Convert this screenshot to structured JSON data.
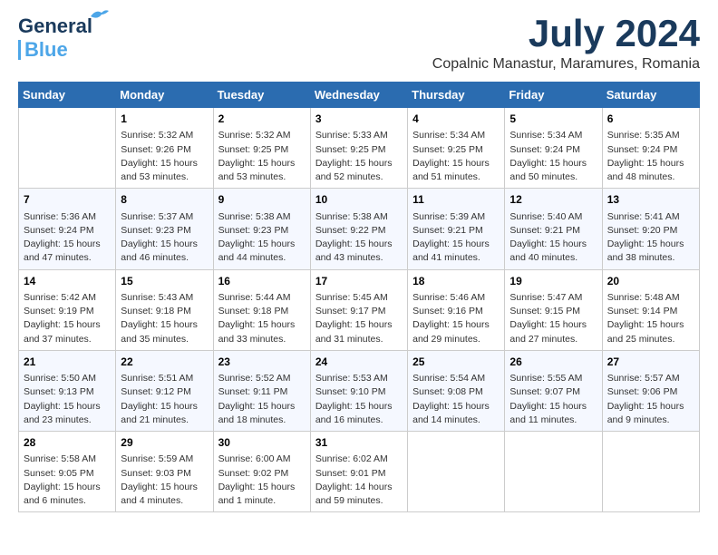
{
  "header": {
    "logo_line1": "General",
    "logo_line2": "Blue",
    "month": "July 2024",
    "location": "Copalnic Manastur, Maramures, Romania"
  },
  "days_of_week": [
    "Sunday",
    "Monday",
    "Tuesday",
    "Wednesday",
    "Thursday",
    "Friday",
    "Saturday"
  ],
  "weeks": [
    [
      {
        "day": "",
        "content": ""
      },
      {
        "day": "1",
        "content": "Sunrise: 5:32 AM\nSunset: 9:26 PM\nDaylight: 15 hours\nand 53 minutes."
      },
      {
        "day": "2",
        "content": "Sunrise: 5:32 AM\nSunset: 9:25 PM\nDaylight: 15 hours\nand 53 minutes."
      },
      {
        "day": "3",
        "content": "Sunrise: 5:33 AM\nSunset: 9:25 PM\nDaylight: 15 hours\nand 52 minutes."
      },
      {
        "day": "4",
        "content": "Sunrise: 5:34 AM\nSunset: 9:25 PM\nDaylight: 15 hours\nand 51 minutes."
      },
      {
        "day": "5",
        "content": "Sunrise: 5:34 AM\nSunset: 9:24 PM\nDaylight: 15 hours\nand 50 minutes."
      },
      {
        "day": "6",
        "content": "Sunrise: 5:35 AM\nSunset: 9:24 PM\nDaylight: 15 hours\nand 48 minutes."
      }
    ],
    [
      {
        "day": "7",
        "content": "Sunrise: 5:36 AM\nSunset: 9:24 PM\nDaylight: 15 hours\nand 47 minutes."
      },
      {
        "day": "8",
        "content": "Sunrise: 5:37 AM\nSunset: 9:23 PM\nDaylight: 15 hours\nand 46 minutes."
      },
      {
        "day": "9",
        "content": "Sunrise: 5:38 AM\nSunset: 9:23 PM\nDaylight: 15 hours\nand 44 minutes."
      },
      {
        "day": "10",
        "content": "Sunrise: 5:38 AM\nSunset: 9:22 PM\nDaylight: 15 hours\nand 43 minutes."
      },
      {
        "day": "11",
        "content": "Sunrise: 5:39 AM\nSunset: 9:21 PM\nDaylight: 15 hours\nand 41 minutes."
      },
      {
        "day": "12",
        "content": "Sunrise: 5:40 AM\nSunset: 9:21 PM\nDaylight: 15 hours\nand 40 minutes."
      },
      {
        "day": "13",
        "content": "Sunrise: 5:41 AM\nSunset: 9:20 PM\nDaylight: 15 hours\nand 38 minutes."
      }
    ],
    [
      {
        "day": "14",
        "content": "Sunrise: 5:42 AM\nSunset: 9:19 PM\nDaylight: 15 hours\nand 37 minutes."
      },
      {
        "day": "15",
        "content": "Sunrise: 5:43 AM\nSunset: 9:18 PM\nDaylight: 15 hours\nand 35 minutes."
      },
      {
        "day": "16",
        "content": "Sunrise: 5:44 AM\nSunset: 9:18 PM\nDaylight: 15 hours\nand 33 minutes."
      },
      {
        "day": "17",
        "content": "Sunrise: 5:45 AM\nSunset: 9:17 PM\nDaylight: 15 hours\nand 31 minutes."
      },
      {
        "day": "18",
        "content": "Sunrise: 5:46 AM\nSunset: 9:16 PM\nDaylight: 15 hours\nand 29 minutes."
      },
      {
        "day": "19",
        "content": "Sunrise: 5:47 AM\nSunset: 9:15 PM\nDaylight: 15 hours\nand 27 minutes."
      },
      {
        "day": "20",
        "content": "Sunrise: 5:48 AM\nSunset: 9:14 PM\nDaylight: 15 hours\nand 25 minutes."
      }
    ],
    [
      {
        "day": "21",
        "content": "Sunrise: 5:50 AM\nSunset: 9:13 PM\nDaylight: 15 hours\nand 23 minutes."
      },
      {
        "day": "22",
        "content": "Sunrise: 5:51 AM\nSunset: 9:12 PM\nDaylight: 15 hours\nand 21 minutes."
      },
      {
        "day": "23",
        "content": "Sunrise: 5:52 AM\nSunset: 9:11 PM\nDaylight: 15 hours\nand 18 minutes."
      },
      {
        "day": "24",
        "content": "Sunrise: 5:53 AM\nSunset: 9:10 PM\nDaylight: 15 hours\nand 16 minutes."
      },
      {
        "day": "25",
        "content": "Sunrise: 5:54 AM\nSunset: 9:08 PM\nDaylight: 15 hours\nand 14 minutes."
      },
      {
        "day": "26",
        "content": "Sunrise: 5:55 AM\nSunset: 9:07 PM\nDaylight: 15 hours\nand 11 minutes."
      },
      {
        "day": "27",
        "content": "Sunrise: 5:57 AM\nSunset: 9:06 PM\nDaylight: 15 hours\nand 9 minutes."
      }
    ],
    [
      {
        "day": "28",
        "content": "Sunrise: 5:58 AM\nSunset: 9:05 PM\nDaylight: 15 hours\nand 6 minutes."
      },
      {
        "day": "29",
        "content": "Sunrise: 5:59 AM\nSunset: 9:03 PM\nDaylight: 15 hours\nand 4 minutes."
      },
      {
        "day": "30",
        "content": "Sunrise: 6:00 AM\nSunset: 9:02 PM\nDaylight: 15 hours\nand 1 minute."
      },
      {
        "day": "31",
        "content": "Sunrise: 6:02 AM\nSunset: 9:01 PM\nDaylight: 14 hours\nand 59 minutes."
      },
      {
        "day": "",
        "content": ""
      },
      {
        "day": "",
        "content": ""
      },
      {
        "day": "",
        "content": ""
      }
    ]
  ]
}
